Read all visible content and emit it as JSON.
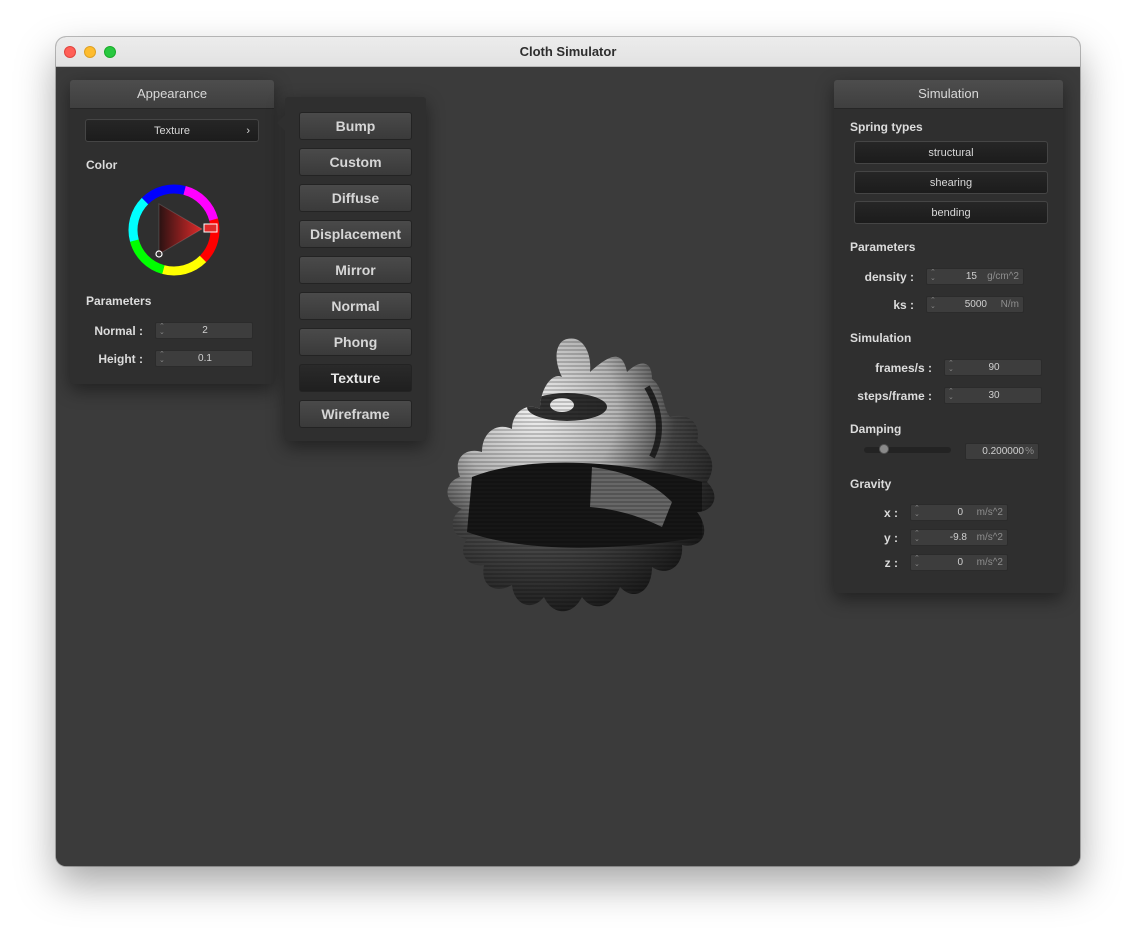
{
  "window": {
    "title": "Cloth Simulator"
  },
  "appearance": {
    "header": "Appearance",
    "shader_select": "Texture",
    "color_label": "Color",
    "parameters_label": "Parameters",
    "normal_label": "Normal :",
    "normal_value": "2",
    "height_label": "Height :",
    "height_value": "0.1"
  },
  "shader_menu": {
    "items": [
      {
        "label": "Bump"
      },
      {
        "label": "Custom"
      },
      {
        "label": "Diffuse"
      },
      {
        "label": "Displacement"
      },
      {
        "label": "Mirror"
      },
      {
        "label": "Normal"
      },
      {
        "label": "Phong"
      },
      {
        "label": "Texture"
      },
      {
        "label": "Wireframe"
      }
    ],
    "selected": "Texture"
  },
  "simulation": {
    "header": "Simulation",
    "spring_types_label": "Spring types",
    "spring_types": [
      "structural",
      "shearing",
      "bending"
    ],
    "parameters_label": "Parameters",
    "density_label": "density :",
    "density_value": "15",
    "density_unit": "g/cm^2",
    "ks_label": "ks :",
    "ks_value": "5000",
    "ks_unit": "N/m",
    "simulation_label": "Simulation",
    "fps_label": "frames/s :",
    "fps_value": "90",
    "steps_label": "steps/frame :",
    "steps_value": "30",
    "damping_label": "Damping",
    "damping_value": "0.200000",
    "damping_unit": "%",
    "damping_slider_fraction": 0.2,
    "gravity_label": "Gravity",
    "gx_label": "x :",
    "gx_value": "0",
    "gy_label": "y :",
    "gy_value": "-9.8",
    "gz_label": "z :",
    "gz_value": "0",
    "gravity_unit": "m/s^2"
  },
  "colors": {
    "background": "#3b3b3b",
    "panel": "#2f2f2f",
    "selected_color": "#e02a2a"
  }
}
